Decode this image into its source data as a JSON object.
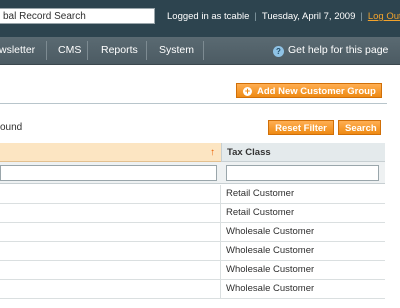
{
  "header": {
    "global_search_value": "bal Record Search",
    "logged_in": "Logged in as tcable",
    "date": "Tuesday, April 7, 2009",
    "logout": "Log Out"
  },
  "nav": {
    "items": [
      "wsletter",
      "CMS",
      "Reports",
      "System"
    ],
    "help": "Get help for this page"
  },
  "actions": {
    "add_group": "Add New Customer Group",
    "reset_filter": "Reset Filter",
    "search": "Search"
  },
  "grid": {
    "records_found": "ound",
    "sort_indicator": "↑",
    "column_tax_class": "Tax Class",
    "rows": [
      {
        "tax_class": "Retail Customer"
      },
      {
        "tax_class": "Retail Customer"
      },
      {
        "tax_class": "Wholesale Customer"
      },
      {
        "tax_class": "Wholesale Customer"
      },
      {
        "tax_class": "Wholesale Customer"
      },
      {
        "tax_class": "Wholesale Customer"
      }
    ]
  },
  "colors": {
    "header_bg": "#2d444f",
    "nav_bg": "#52616a",
    "accent_orange": "#ee8a14",
    "sorted_header": "#fce5c2"
  }
}
